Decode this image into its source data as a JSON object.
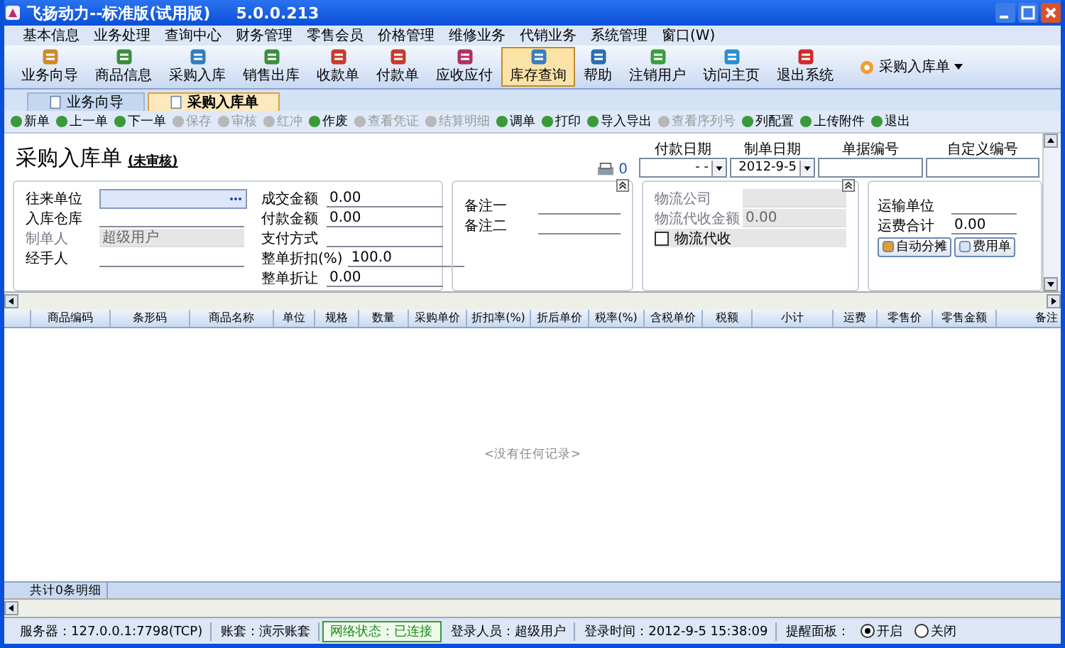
{
  "window": {
    "title": "飞扬动力--标准版(试用版)",
    "version": "5.0.0.213"
  },
  "menu": [
    "基本信息",
    "业务处理",
    "查询中心",
    "财务管理",
    "零售会员",
    "价格管理",
    "维修业务",
    "代销业务",
    "系统管理",
    "窗口(W)"
  ],
  "toolbar": [
    {
      "label": "业务向导",
      "selected": false
    },
    {
      "label": "商品信息",
      "selected": false
    },
    {
      "label": "采购入库",
      "selected": false
    },
    {
      "label": "销售出库",
      "selected": false
    },
    {
      "label": "收款单",
      "selected": false
    },
    {
      "label": "付款单",
      "selected": false
    },
    {
      "label": "应收应付",
      "selected": false
    },
    {
      "label": "库存查询",
      "selected": true
    },
    {
      "label": "帮助",
      "selected": false
    },
    {
      "label": "注销用户",
      "selected": false
    },
    {
      "label": "访问主页",
      "selected": false
    },
    {
      "label": "退出系统",
      "selected": false
    }
  ],
  "toolbar_dropdown": "采购入库单",
  "doc_tabs": [
    {
      "label": "业务向导",
      "selected": false
    },
    {
      "label": "采购入库单",
      "selected": true
    }
  ],
  "actions": [
    {
      "label": "新单",
      "disabled": false
    },
    {
      "label": "上一单",
      "disabled": false
    },
    {
      "label": "下一单",
      "disabled": false
    },
    {
      "label": "保存",
      "disabled": true
    },
    {
      "label": "审核",
      "disabled": true
    },
    {
      "label": "红冲",
      "disabled": true
    },
    {
      "label": "作废",
      "disabled": false
    },
    {
      "label": "查看凭证",
      "disabled": true
    },
    {
      "label": "结算明细",
      "disabled": true
    },
    {
      "label": "调单",
      "disabled": false
    },
    {
      "label": "打印",
      "disabled": false
    },
    {
      "label": "导入导出",
      "disabled": false
    },
    {
      "label": "查看序列号",
      "disabled": true
    },
    {
      "label": "列配置",
      "disabled": false
    },
    {
      "label": "上传附件",
      "disabled": false
    },
    {
      "label": "退出",
      "disabled": false
    }
  ],
  "form": {
    "title": "采购入库单",
    "status": "(未审核)",
    "print_count": "0"
  },
  "header_fields": [
    {
      "label": "付款日期",
      "value": "- -"
    },
    {
      "label": "制单日期",
      "value": "2012-9-5"
    },
    {
      "label": "单据编号"
    },
    {
      "label": "自定义编号"
    }
  ],
  "main_fields": [
    {
      "label": "往来单位",
      "disabled": false,
      "lookup": true
    },
    {
      "label": "入库仓库",
      "disabled": false
    },
    {
      "label": "制单人",
      "value": "超级用户",
      "disabled": true
    },
    {
      "label": "经手人",
      "disabled": false
    }
  ],
  "amount_fields": [
    {
      "label": "成交金额",
      "value": "0.00"
    },
    {
      "label": "付款金额",
      "value": "0.00"
    },
    {
      "label": "支付方式"
    },
    {
      "label": "整单折扣(%)",
      "value": "100.0"
    },
    {
      "label": "整单折让",
      "value": "0.00"
    }
  ],
  "remark_fields": [
    {
      "label": "备注一"
    },
    {
      "label": "备注二"
    }
  ],
  "logistics": {
    "fields": [
      {
        "label": "物流公司"
      },
      {
        "label": "物流代收金额",
        "value": "0.00"
      }
    ],
    "disabled": true,
    "collect_label": "物流代收",
    "collect_checked": false
  },
  "freight": {
    "fields": [
      {
        "label": "运输单位"
      },
      {
        "label": "运费合计",
        "value": "0.00"
      }
    ],
    "buttons": [
      "自动分摊",
      "费用单"
    ]
  },
  "grid": {
    "columns": [
      "商品编码",
      "条形码",
      "商品名称",
      "单位",
      "规格",
      "数量",
      "采购单价",
      "折扣率(%)",
      "折后单价",
      "税率(%)",
      "含税单价",
      "税额",
      "小计",
      "运费",
      "零售价",
      "零售金额",
      "备注"
    ],
    "empty_text": "<没有任何记录>",
    "footer": "共计0条明细"
  },
  "status_bar": {
    "server": "服务器：127.0.0.1:7798(TCP)",
    "account": "账套：演示账套",
    "network": "网络状态：已连接",
    "user": "登录人员：超级用户",
    "login_time": "登录时间：2012-9-5 15:38:09",
    "reminder_label": "提醒面板：",
    "reminder_options": [
      {
        "label": "开启",
        "selected": true
      },
      {
        "label": "关闭",
        "selected": false
      }
    ]
  }
}
